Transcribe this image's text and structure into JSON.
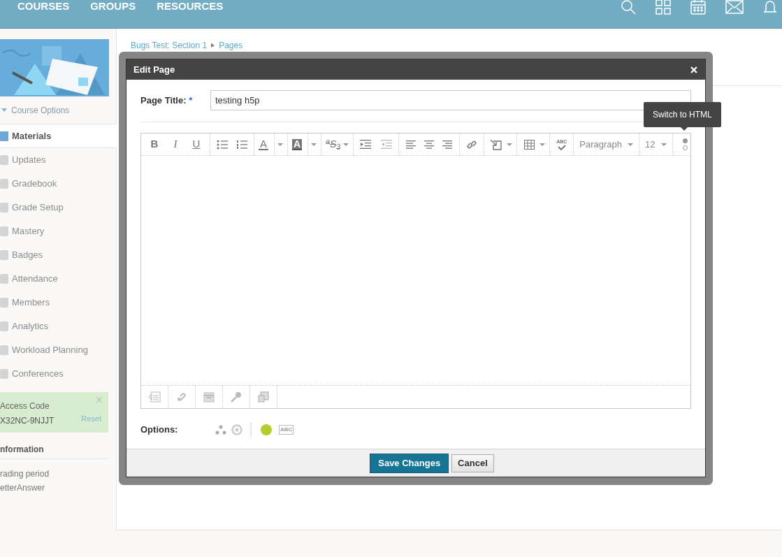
{
  "top_nav": {
    "items": [
      "COURSES",
      "GROUPS",
      "RESOURCES"
    ]
  },
  "sidebar": {
    "course_options": "Course Options",
    "items": [
      {
        "label": "Materials",
        "selected": true
      },
      {
        "label": "Updates",
        "selected": false
      },
      {
        "label": "Gradebook",
        "selected": false
      },
      {
        "label": "Grade Setup",
        "selected": false
      },
      {
        "label": "Mastery",
        "selected": false
      },
      {
        "label": "Badges",
        "selected": false
      },
      {
        "label": "Attendance",
        "selected": false
      },
      {
        "label": "Members",
        "selected": false
      },
      {
        "label": "Analytics",
        "selected": false
      },
      {
        "label": "Workload Planning",
        "selected": false
      },
      {
        "label": "Conferences",
        "selected": false
      }
    ],
    "access_code": {
      "title": "Access Code",
      "code": "X32NC-9NJJT",
      "reset": "Reset"
    },
    "information": {
      "title": "nformation",
      "lines": [
        "rading period",
        "etterAnswer"
      ]
    }
  },
  "breadcrumb": [
    "Bugs Test: Section 1",
    "Pages"
  ],
  "dialog": {
    "title": "Edit Page",
    "page_title_label": "Page Title:",
    "required_mark": "*",
    "page_title_value": "testing h5p",
    "toolbar": {
      "letters": [
        "B",
        "I",
        "U"
      ],
      "text_color_glyph": "A",
      "highlight_glyph": "A",
      "script_glyph": "$^{a}$S$_{3}$",
      "spellcheck_glyph": "ABC",
      "dropdowns": [
        "Paragraph",
        "12"
      ]
    },
    "tooltip": "Switch to HTML",
    "options_label": "Options:",
    "options_abc": "ABC",
    "buttons": [
      {
        "label": "Save Changes",
        "kind": "primary"
      },
      {
        "label": "Cancel",
        "kind": "secondary"
      }
    ]
  }
}
